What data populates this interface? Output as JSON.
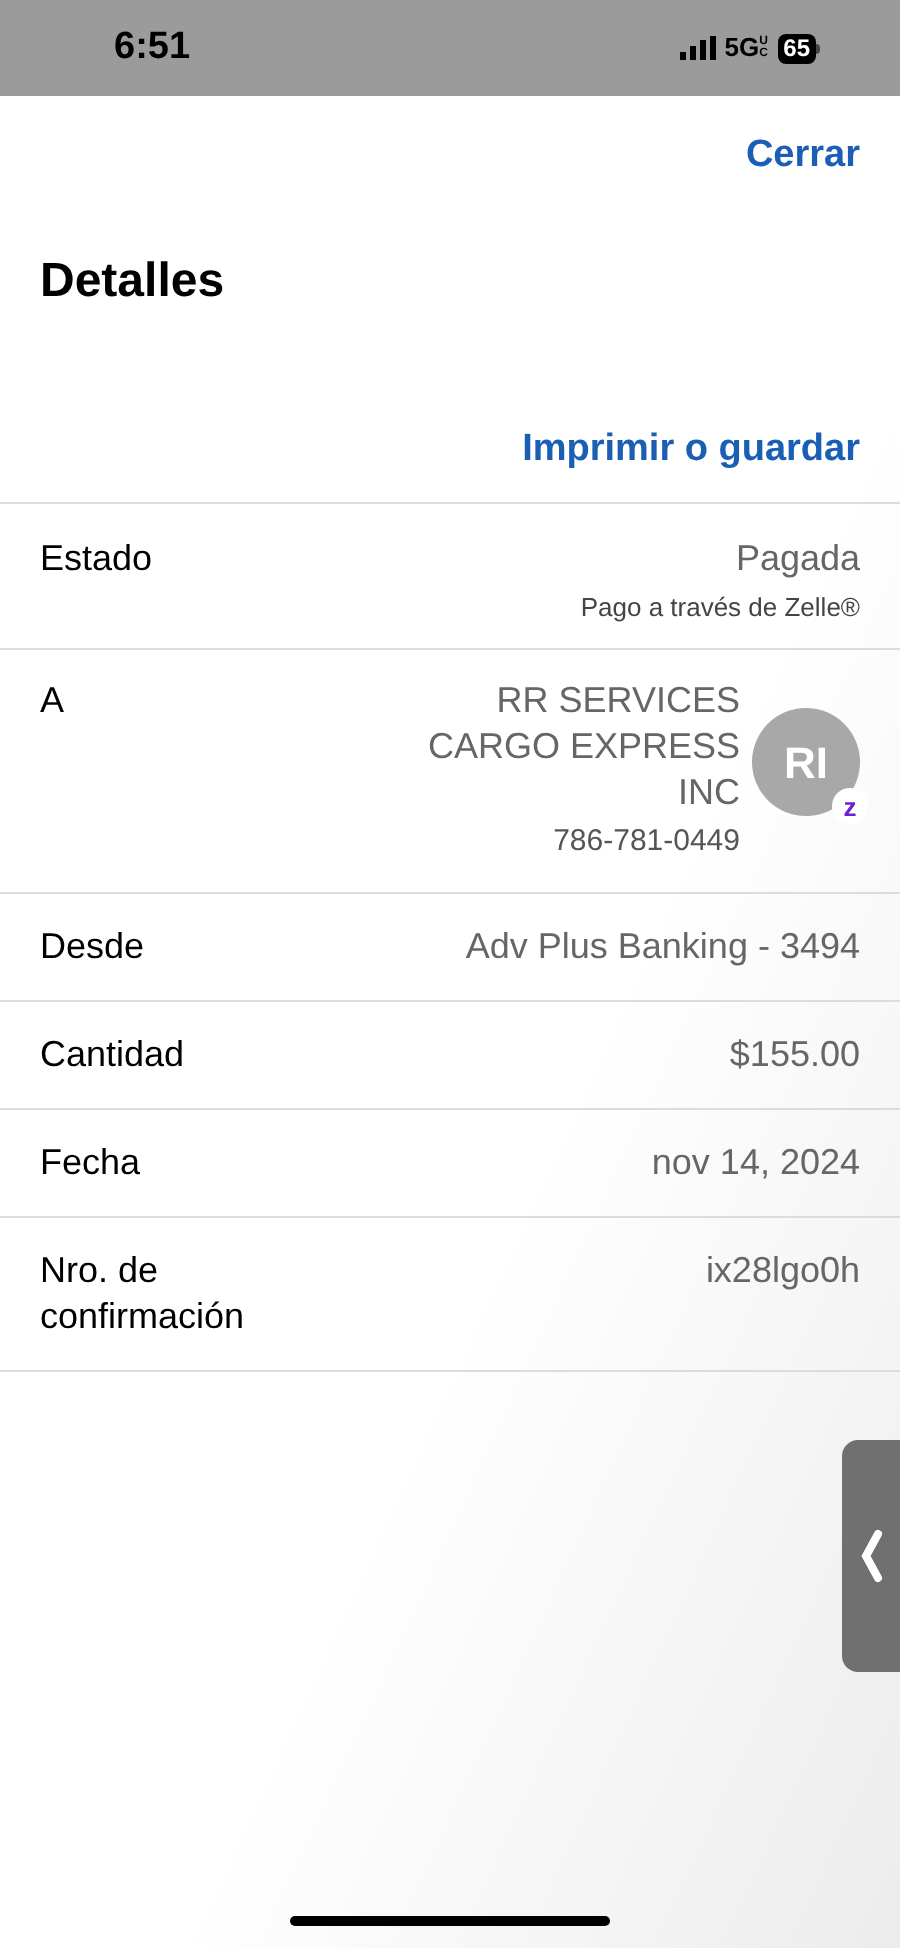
{
  "status_bar": {
    "time": "6:51",
    "network": "5G",
    "network_suffix": "UC",
    "battery": "65"
  },
  "close": "Cerrar",
  "title": "Detalles",
  "print": "Imprimir o guardar",
  "rows": [
    {
      "kind": "status",
      "label": "Estado",
      "value": "Pagada",
      "note": "Pago a través de Zelle®"
    },
    {
      "kind": "recipient",
      "label": "A",
      "value_lines": [
        "RR SERVICES",
        "CARGO EXPRESS",
        "INC"
      ],
      "phone": "786-781-0449",
      "avatar": "RI",
      "badge": "z"
    },
    {
      "kind": "plain",
      "label": "Desde",
      "value": "Adv Plus Banking - 3494"
    },
    {
      "kind": "plain",
      "label": "Cantidad",
      "value": "$155.00"
    },
    {
      "kind": "plain",
      "label": "Fecha",
      "value": "nov 14, 2024"
    },
    {
      "kind": "plain",
      "label": "Nro. de confirmación",
      "value": "ix28lgo0h"
    }
  ]
}
